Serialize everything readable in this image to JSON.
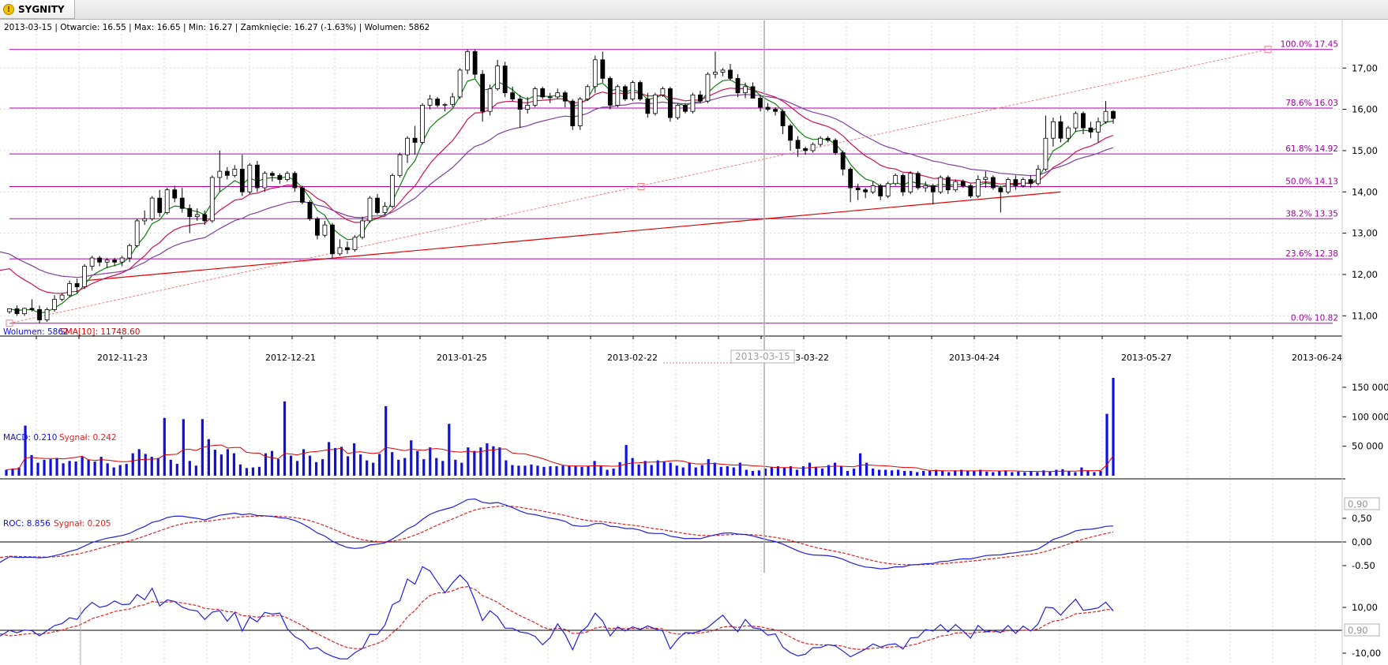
{
  "tab": {
    "title": "SYGNITY",
    "icon": "warning-icon"
  },
  "price_info": "2013-03-15 | Otwarcie: 16.55 | Max: 16.65 | Min: 16.27 | Zamknięcie: 16.27 (-1.63%)  | Wolumen: 5862",
  "volume_info": {
    "vol": "Wolumen: 5862",
    "sma": "SMA[10]: 11748.60"
  },
  "macd_info": {
    "macd": "MACD: 0.210",
    "signal": "Sygnał: 0.242"
  },
  "roc_info": {
    "roc": "ROC: 8.856",
    "signal": "Sygnał: 0.205"
  },
  "crosshair_date": "2013-03-15",
  "colors": {
    "fib": "#b000b0",
    "fib_text": "#a000a0",
    "trend": "#e00000",
    "trend_dashed": "#f08080",
    "ma_fast": "#108010",
    "ma_mid": "#d01050",
    "ma_slow": "#8040a0",
    "volume": "#1010e0",
    "sma": "#e00000",
    "macd": "#2020e0",
    "signal": "#e02020"
  },
  "chart_data": [
    {
      "type": "candlestick",
      "name": "price",
      "x_labels": [
        "2012-11-23",
        "2012-12-21",
        "2013-01-25",
        "2013-02-22",
        "2013-03-22",
        "2013-04-24",
        "2013-05-27",
        "2013-06-24"
      ],
      "ylim": [
        10.7,
        17.75
      ],
      "y_ticks": [
        "11,00",
        "12,00",
        "13,00",
        "14,00",
        "15,00",
        "16,00",
        "17,00"
      ],
      "fib_levels": [
        {
          "label": "100.0% 17.45",
          "value": 17.45
        },
        {
          "label": "78.6% 16.03",
          "value": 16.03
        },
        {
          "label": "61.8% 14.92",
          "value": 14.92
        },
        {
          "label": "50.0% 14.13",
          "value": 14.13
        },
        {
          "label": "38.2% 13.35",
          "value": 13.35
        },
        {
          "label": "23.6% 12.38",
          "value": 12.38
        },
        {
          "label": "0.0% 10.82",
          "value": 10.82
        }
      ],
      "candles": [
        [
          11.1,
          11.18,
          11.05,
          11.17
        ],
        [
          11.17,
          11.25,
          11.0,
          11.05
        ],
        [
          11.05,
          11.2,
          11.0,
          11.18
        ],
        [
          11.18,
          11.4,
          11.1,
          11.15
        ],
        [
          11.15,
          11.25,
          10.82,
          10.9
        ],
        [
          10.9,
          11.2,
          10.85,
          11.15
        ],
        [
          11.15,
          11.5,
          11.1,
          11.4
        ],
        [
          11.4,
          11.55,
          11.35,
          11.5
        ],
        [
          11.5,
          11.85,
          11.45,
          11.78
        ],
        [
          11.78,
          11.9,
          11.55,
          11.7
        ],
        [
          11.7,
          12.25,
          11.65,
          12.2
        ],
        [
          12.2,
          12.45,
          12.1,
          12.4
        ],
        [
          12.4,
          12.45,
          12.2,
          12.3
        ],
        [
          12.3,
          12.4,
          12.15,
          12.35
        ],
        [
          12.35,
          12.4,
          12.2,
          12.3
        ],
        [
          12.3,
          12.45,
          12.2,
          12.4
        ],
        [
          12.4,
          12.75,
          12.3,
          12.7
        ],
        [
          12.7,
          13.35,
          12.65,
          13.3
        ],
        [
          13.3,
          13.55,
          13.2,
          13.35
        ],
        [
          13.35,
          13.9,
          13.3,
          13.85
        ],
        [
          13.85,
          14.05,
          13.4,
          13.5
        ],
        [
          13.5,
          14.1,
          13.45,
          14.05
        ],
        [
          14.05,
          14.15,
          13.75,
          13.85
        ],
        [
          13.85,
          14.1,
          13.5,
          13.6
        ],
        [
          13.6,
          13.7,
          13.0,
          13.4
        ],
        [
          13.4,
          13.6,
          13.3,
          13.45
        ],
        [
          13.45,
          13.55,
          13.2,
          13.3
        ],
        [
          13.3,
          14.4,
          13.25,
          14.35
        ],
        [
          14.35,
          15.0,
          14.0,
          14.5
        ],
        [
          14.5,
          14.6,
          14.3,
          14.4
        ],
        [
          14.4,
          14.65,
          14.35,
          14.55
        ],
        [
          14.55,
          14.9,
          13.9,
          14.0
        ],
        [
          14.0,
          14.7,
          13.95,
          14.65
        ],
        [
          14.65,
          14.75,
          14.0,
          14.1
        ],
        [
          14.1,
          14.5,
          14.0,
          14.45
        ],
        [
          14.45,
          14.5,
          14.25,
          14.4
        ],
        [
          14.4,
          14.45,
          14.2,
          14.3
        ],
        [
          14.3,
          14.5,
          14.25,
          14.45
        ],
        [
          14.45,
          14.5,
          14.0,
          14.1
        ],
        [
          14.1,
          14.15,
          13.7,
          13.75
        ],
        [
          13.75,
          13.8,
          13.3,
          13.35
        ],
        [
          13.35,
          13.4,
          12.85,
          12.95
        ],
        [
          12.95,
          13.3,
          12.9,
          13.2
        ],
        [
          13.2,
          13.25,
          12.4,
          12.5
        ],
        [
          12.5,
          12.85,
          12.45,
          12.65
        ],
        [
          12.65,
          12.8,
          12.5,
          12.6
        ],
        [
          12.6,
          12.95,
          12.55,
          12.9
        ],
        [
          12.9,
          13.4,
          12.85,
          13.3
        ],
        [
          13.3,
          13.9,
          13.25,
          13.85
        ],
        [
          13.85,
          13.95,
          13.45,
          13.5
        ],
        [
          13.5,
          13.75,
          13.45,
          13.65
        ],
        [
          13.65,
          14.45,
          13.6,
          14.4
        ],
        [
          14.4,
          14.95,
          14.35,
          14.9
        ],
        [
          14.9,
          15.35,
          14.7,
          15.3
        ],
        [
          15.3,
          15.6,
          14.9,
          15.2
        ],
        [
          15.2,
          16.15,
          15.15,
          16.1
        ],
        [
          16.1,
          16.35,
          16.0,
          16.25
        ],
        [
          16.25,
          16.3,
          16.05,
          16.1
        ],
        [
          16.1,
          16.15,
          15.95,
          16.12
        ],
        [
          16.12,
          16.4,
          16.05,
          16.3
        ],
        [
          16.3,
          17.0,
          16.25,
          16.95
        ],
        [
          16.95,
          17.45,
          16.85,
          17.4
        ],
        [
          17.4,
          17.45,
          16.75,
          16.85
        ],
        [
          16.85,
          16.95,
          15.7,
          15.95
        ],
        [
          15.95,
          16.6,
          15.85,
          16.5
        ],
        [
          16.5,
          17.2,
          16.45,
          17.05
        ],
        [
          17.05,
          17.15,
          16.3,
          16.4
        ],
        [
          16.4,
          16.55,
          16.2,
          16.25
        ],
        [
          16.25,
          16.35,
          15.55,
          16.0
        ],
        [
          16.0,
          16.3,
          15.9,
          16.1
        ],
        [
          16.1,
          16.55,
          16.05,
          16.5
        ],
        [
          16.5,
          16.55,
          16.25,
          16.3
        ],
        [
          16.3,
          16.4,
          16.15,
          16.3
        ],
        [
          16.3,
          16.5,
          16.25,
          16.4
        ],
        [
          16.4,
          16.45,
          16.05,
          16.2
        ],
        [
          16.2,
          16.25,
          15.5,
          15.6
        ],
        [
          15.6,
          16.3,
          15.5,
          16.25
        ],
        [
          16.25,
          16.6,
          16.2,
          16.55
        ],
        [
          16.55,
          17.3,
          16.4,
          17.2
        ],
        [
          17.2,
          17.4,
          16.65,
          16.75
        ],
        [
          16.75,
          16.8,
          16.0,
          16.1
        ],
        [
          16.1,
          16.6,
          16.05,
          16.55
        ],
        [
          16.55,
          16.6,
          16.2,
          16.25
        ],
        [
          16.25,
          16.7,
          16.2,
          16.65
        ],
        [
          16.65,
          16.7,
          16.2,
          16.25
        ],
        [
          16.25,
          16.4,
          15.8,
          15.9
        ],
        [
          15.9,
          16.4,
          15.85,
          16.35
        ],
        [
          16.35,
          16.55,
          16.3,
          16.5
        ],
        [
          16.5,
          16.55,
          15.7,
          15.8
        ],
        [
          15.8,
          16.15,
          15.75,
          16.1
        ],
        [
          16.1,
          16.15,
          15.9,
          15.95
        ],
        [
          15.95,
          16.4,
          15.9,
          16.35
        ],
        [
          16.35,
          16.45,
          16.15,
          16.2
        ],
        [
          16.2,
          16.9,
          16.15,
          16.85
        ],
        [
          16.85,
          17.4,
          16.75,
          16.9
        ],
        [
          16.9,
          17.0,
          16.8,
          16.95
        ],
        [
          16.95,
          17.1,
          16.7,
          16.75
        ],
        [
          16.75,
          16.85,
          16.3,
          16.4
        ],
        [
          16.4,
          16.65,
          16.27,
          16.55
        ],
        [
          16.55,
          16.65,
          16.27,
          16.27
        ],
        [
          16.27,
          16.35,
          15.95,
          16.05
        ],
        [
          16.05,
          16.15,
          15.95,
          16.0
        ],
        [
          16.0,
          16.05,
          15.85,
          15.95
        ],
        [
          15.95,
          16.0,
          15.4,
          15.6
        ],
        [
          15.6,
          15.65,
          15.0,
          15.25
        ],
        [
          15.25,
          15.35,
          14.85,
          15.05
        ],
        [
          15.05,
          15.1,
          14.9,
          15.0
        ],
        [
          15.0,
          15.2,
          14.95,
          15.15
        ],
        [
          15.15,
          15.35,
          15.1,
          15.3
        ],
        [
          15.3,
          15.35,
          15.2,
          15.25
        ],
        [
          15.25,
          15.3,
          14.9,
          14.95
        ],
        [
          14.95,
          15.0,
          14.4,
          14.55
        ],
        [
          14.55,
          14.6,
          13.75,
          14.1
        ],
        [
          14.1,
          14.2,
          13.8,
          14.05
        ],
        [
          14.05,
          14.1,
          13.85,
          14.0
        ],
        [
          14.0,
          14.25,
          13.95,
          14.15
        ],
        [
          14.15,
          14.2,
          13.8,
          13.9
        ],
        [
          13.9,
          14.25,
          13.85,
          14.2
        ],
        [
          14.2,
          14.45,
          14.15,
          14.4
        ],
        [
          14.4,
          14.45,
          13.9,
          14.0
        ],
        [
          14.0,
          14.5,
          13.95,
          14.45
        ],
        [
          14.45,
          14.5,
          14.05,
          14.1
        ],
        [
          14.1,
          14.25,
          14.0,
          14.15
        ],
        [
          14.15,
          14.2,
          13.7,
          14.0
        ],
        [
          14.0,
          14.4,
          13.95,
          14.35
        ],
        [
          14.35,
          14.4,
          13.95,
          14.05
        ],
        [
          14.05,
          14.3,
          14.0,
          14.25
        ],
        [
          14.25,
          14.3,
          14.1,
          14.15
        ],
        [
          14.15,
          14.2,
          13.85,
          13.9
        ],
        [
          13.9,
          14.4,
          13.85,
          14.3
        ],
        [
          14.3,
          14.5,
          14.1,
          14.35
        ],
        [
          14.35,
          14.4,
          14.05,
          14.1
        ],
        [
          14.1,
          14.15,
          13.5,
          14.0
        ],
        [
          14.0,
          14.35,
          13.95,
          14.3
        ],
        [
          14.3,
          14.4,
          14.05,
          14.15
        ],
        [
          14.15,
          14.35,
          14.1,
          14.3
        ],
        [
          14.3,
          14.4,
          14.1,
          14.2
        ],
        [
          14.2,
          14.65,
          14.15,
          14.55
        ],
        [
          14.55,
          15.85,
          14.5,
          15.3
        ],
        [
          15.3,
          15.8,
          15.1,
          15.7
        ],
        [
          15.7,
          15.85,
          15.2,
          15.3
        ],
        [
          15.3,
          15.6,
          15.2,
          15.55
        ],
        [
          15.55,
          15.95,
          15.45,
          15.9
        ],
        [
          15.9,
          15.95,
          15.4,
          15.55
        ],
        [
          15.55,
          15.7,
          15.3,
          15.45
        ],
        [
          15.45,
          15.8,
          15.2,
          15.7
        ],
        [
          15.7,
          16.2,
          15.65,
          15.95
        ],
        [
          15.95,
          15.98,
          15.65,
          15.78
        ]
      ],
      "ma_periods": [
        5,
        13,
        26
      ]
    },
    {
      "type": "bar",
      "name": "volume",
      "y_ticks": [
        "50 000",
        "100 000",
        "150 000"
      ],
      "ylim": [
        0,
        172000
      ],
      "values": [
        10000,
        12000,
        14000,
        85000,
        35000,
        22000,
        27000,
        28000,
        30000,
        21000,
        25000,
        24000,
        32000,
        27000,
        24000,
        32000,
        21000,
        14000,
        18000,
        20000,
        38000,
        45000,
        37000,
        32000,
        30000,
        98000,
        27000,
        20000,
        96000,
        25000,
        17000,
        96000,
        62000,
        44000,
        36000,
        45000,
        38000,
        19000,
        13000,
        14000,
        15000,
        38000,
        42000,
        28000,
        126000,
        34000,
        25000,
        45000,
        34000,
        23000,
        28000,
        57000,
        47000,
        49000,
        33000,
        55000,
        36000,
        26000,
        22000,
        37000,
        118000,
        40000,
        27000,
        30000,
        60000,
        42000,
        28000,
        48000,
        30000,
        25000,
        88000,
        27000,
        22000,
        48000,
        42000,
        48000,
        55000,
        50000,
        48000,
        26000,
        18000,
        17000,
        17000,
        19000,
        17000,
        15000,
        16000,
        16000,
        17000,
        16000,
        16000,
        15000,
        16000,
        25000,
        16000,
        10000,
        12000,
        23000,
        52000,
        30000,
        19000,
        25000,
        18000,
        26000,
        24000,
        22000,
        17000,
        14000,
        22000,
        14000,
        18000,
        28000,
        22000,
        15000,
        16000,
        14000,
        22000,
        10000,
        8000,
        9000,
        12000,
        15000,
        16000,
        14000,
        16000,
        10000,
        16000,
        22000,
        15000,
        12000,
        18000,
        22000,
        16000,
        8000,
        12000,
        38000,
        22000,
        12000,
        10000,
        10000,
        9000,
        10000,
        8000,
        8000,
        6000,
        8000,
        8000,
        10000,
        8000,
        6000,
        9000,
        10000,
        8000,
        8000,
        10000,
        7000,
        6000,
        8000,
        9000,
        6000,
        7000,
        6000,
        7000,
        6000,
        9000,
        7000,
        10000,
        11000,
        8000,
        6000,
        14000,
        8000,
        6000,
        8000,
        105000,
        166000
      ],
      "sma_period": 10
    },
    {
      "type": "line",
      "name": "MACD",
      "y_ticks": [
        "-0.50",
        "0,00",
        "0,50"
      ],
      "ylim": [
        -0.62,
        0.95
      ],
      "marker": "0,90"
    },
    {
      "type": "line",
      "name": "ROC",
      "y_ticks": [
        "-10,00",
        "10,00"
      ],
      "ylim": [
        -13,
        16
      ],
      "marker": "0,90"
    }
  ]
}
